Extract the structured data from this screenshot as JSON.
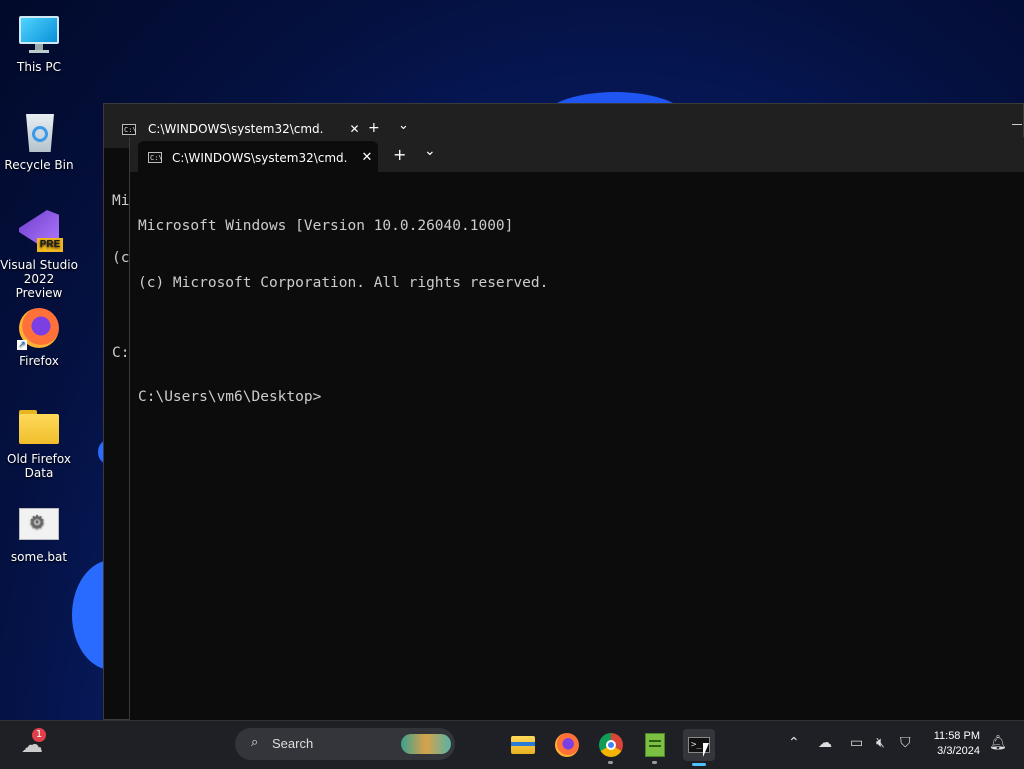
{
  "desktop": {
    "icons": [
      {
        "label": "This PC",
        "icon": "monitor-icon"
      },
      {
        "label": "Recycle Bin",
        "icon": "recycle-bin-icon"
      },
      {
        "label": "Visual Studio 2022 Preview",
        "icon": "visual-studio-icon",
        "badge": "PRE"
      },
      {
        "label": "Firefox",
        "icon": "firefox-icon"
      },
      {
        "label": "Old Firefox Data",
        "icon": "folder-icon"
      },
      {
        "label": "some.bat",
        "icon": "batch-file-icon"
      }
    ]
  },
  "back_window": {
    "tab_title": "C:\\WINDOWS\\system32\\cmd.",
    "lines": [
      "Mi",
      "(c",
      "",
      "C:"
    ]
  },
  "front_window": {
    "tab_title": "C:\\WINDOWS\\system32\\cmd.",
    "tab_icon_text": "C:\\",
    "new_tab_symbol": "+",
    "dropdown_symbol": "⌄",
    "close_symbol": "✕",
    "terminal_lines": [
      "Microsoft Windows [Version 10.0.26040.1000]",
      "(c) Microsoft Corporation. All rights reserved.",
      "",
      "C:\\Users\\vm6\\Desktop>"
    ]
  },
  "taskbar": {
    "search_label": "Search",
    "widget_badge": "1",
    "apps": [
      "file-explorer-icon",
      "firefox-icon",
      "chrome-icon",
      "notepad-icon",
      "terminal-icon"
    ],
    "clock_time": "11:58 PM",
    "clock_date": "3/3/2024"
  },
  "colors": {
    "terminal_bg": "#0c0c0c",
    "tab_bar_bg": "#202020",
    "taskbar_bg": "#1f2026",
    "accent": "#4cc2ff"
  }
}
